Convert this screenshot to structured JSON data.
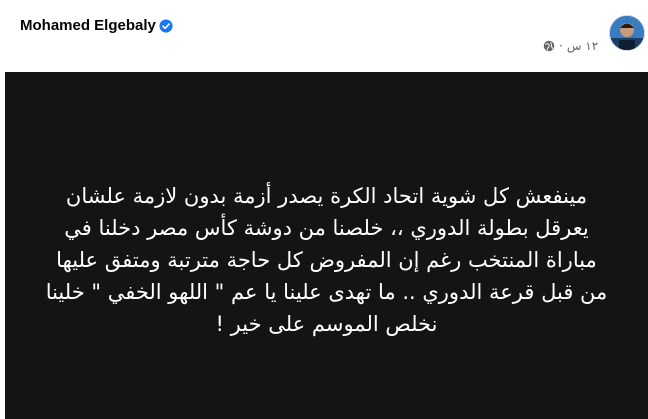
{
  "post": {
    "author": "Mohamed Elgebaly",
    "time": "١٢ س",
    "separator": "·",
    "verified_icon": "verified-badge-icon",
    "privacy_icon": "globe-icon",
    "text_lines": [
      "مينفعش كل شوية اتحاد الكرة يصدر أزمة بدون لازمة علشان",
      "يعرقل بطولة الدوري ،، خلصنا من دوشة كأس مصر دخلنا في",
      "مباراة المنتخب رغم إن المفروض كل حاجة مترتبة ومتفق عليها",
      "من قبل قرعة الدوري .. ما تهدى علينا يا عم \" اللهو الخفي \" خلينا",
      "نخلص الموسم على خير !"
    ]
  },
  "colors": {
    "card_background": "#141414",
    "text": "#ffffff",
    "verified": "#1877f2"
  }
}
